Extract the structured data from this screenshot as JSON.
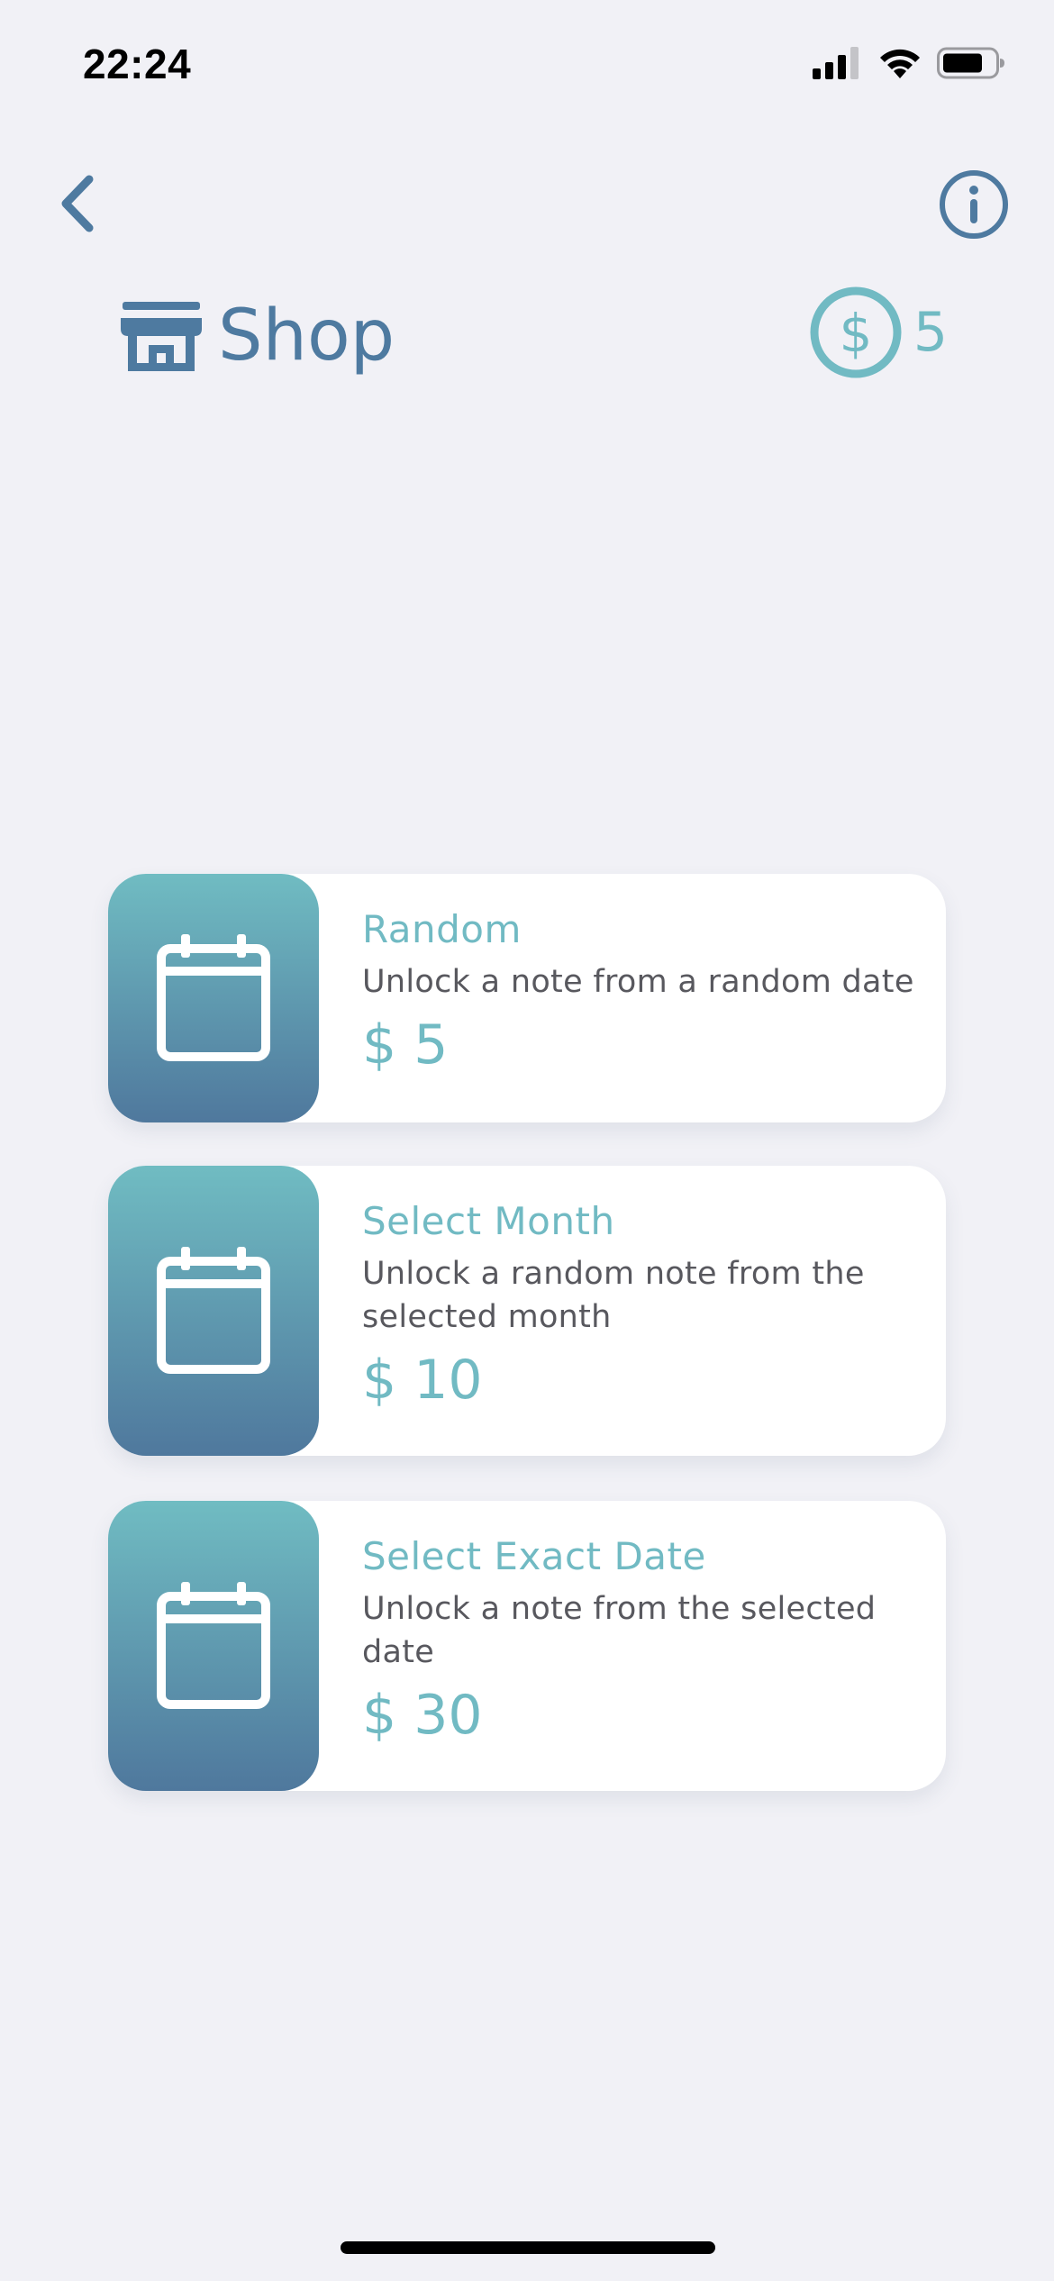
{
  "status_bar": {
    "time": "22:24"
  },
  "nav": {
    "back_icon": "chevron-left-icon",
    "info_icon": "info-circle-icon"
  },
  "header": {
    "icon": "store-icon",
    "title": "Shop",
    "coin_icon": "dollar-circle-icon",
    "coin_count": "5"
  },
  "shop_items": [
    {
      "icon": "calendar-icon",
      "title": "Random",
      "description": "Unlock a note from a random date",
      "price": "$ 5"
    },
    {
      "icon": "calendar-icon",
      "title": "Select Month",
      "description": "Unlock a random note from the selected month",
      "price": "$ 10"
    },
    {
      "icon": "calendar-icon",
      "title": "Select Exact Date",
      "description": "Unlock a note from the selected date",
      "price": "$ 30"
    }
  ],
  "colors": {
    "background": "#f1f1f6",
    "primary_blue": "#4e7aa0",
    "accent_teal": "#71bac3",
    "text_gray": "#58585e",
    "card_background": "#ffffff"
  }
}
